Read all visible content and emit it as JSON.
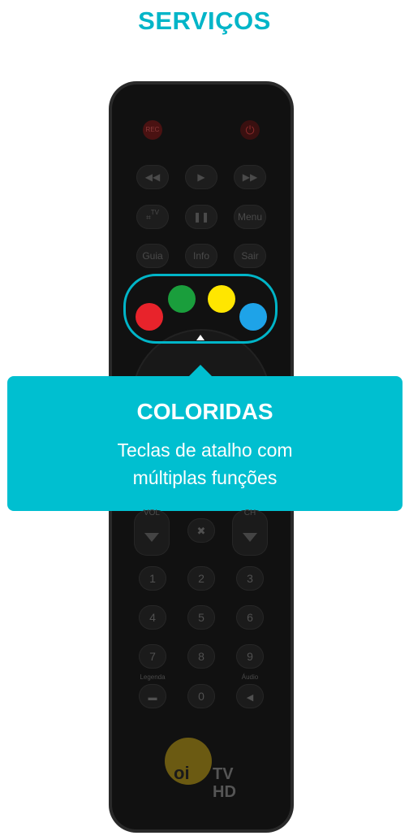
{
  "header": {
    "title": "SERVIÇOS"
  },
  "remote": {
    "rec_label": "REC",
    "power_icon": "power-icon",
    "buttons": {
      "rewind": "◀◀",
      "play": "▶",
      "forward": "▶▶",
      "pause": "❚❚",
      "menu": "Menu",
      "guia": "Guia",
      "info": "Info",
      "sair": "Sair",
      "tv_label": "TV",
      "mute": "🔇"
    },
    "colors": {
      "red": "#e8232b",
      "green": "#1a9e3c",
      "yellow": "#ffe600",
      "blue": "#1ea3e8"
    },
    "rockers": {
      "vol": "VOL",
      "ch": "CH"
    },
    "numbers": [
      "1",
      "2",
      "3",
      "4",
      "5",
      "6",
      "7",
      "8",
      "9",
      "0"
    ],
    "legenda": "Legenda",
    "audio": "Áudio",
    "logo": {
      "oi": "oi",
      "tv": "TV",
      "hd": "HD"
    }
  },
  "callout": {
    "title": "COLORIDAS",
    "line1": "Teclas de atalho com",
    "line2": "múltiplas funções"
  }
}
